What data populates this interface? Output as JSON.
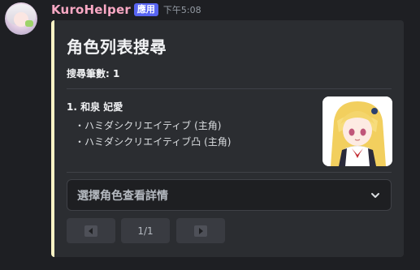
{
  "message": {
    "username": "KuroHelper",
    "app_badge": "應用",
    "timestamp": "下午5:08"
  },
  "embed": {
    "accent_color": "#fbf3c5",
    "title": "角色列表搜尋",
    "search_count": "搜尋筆數: 1",
    "entries": [
      {
        "name": "1. 和泉 妃愛",
        "games": [
          "・ハミダシクリエイティブ (主角)",
          "・ハミダシクリエイティブ凸 (主角)"
        ]
      }
    ]
  },
  "select": {
    "placeholder": "選擇角色查看詳情",
    "icon": "chevron-down-icon"
  },
  "pagination": {
    "prev_icon": "arrow-left-icon",
    "page_label": "1/1",
    "next_icon": "arrow-right-icon"
  },
  "colors": {
    "username": "#f9a8c4",
    "badge": "#5865f2",
    "background": "#1e1f23",
    "embed_background": "#2b2d31"
  }
}
